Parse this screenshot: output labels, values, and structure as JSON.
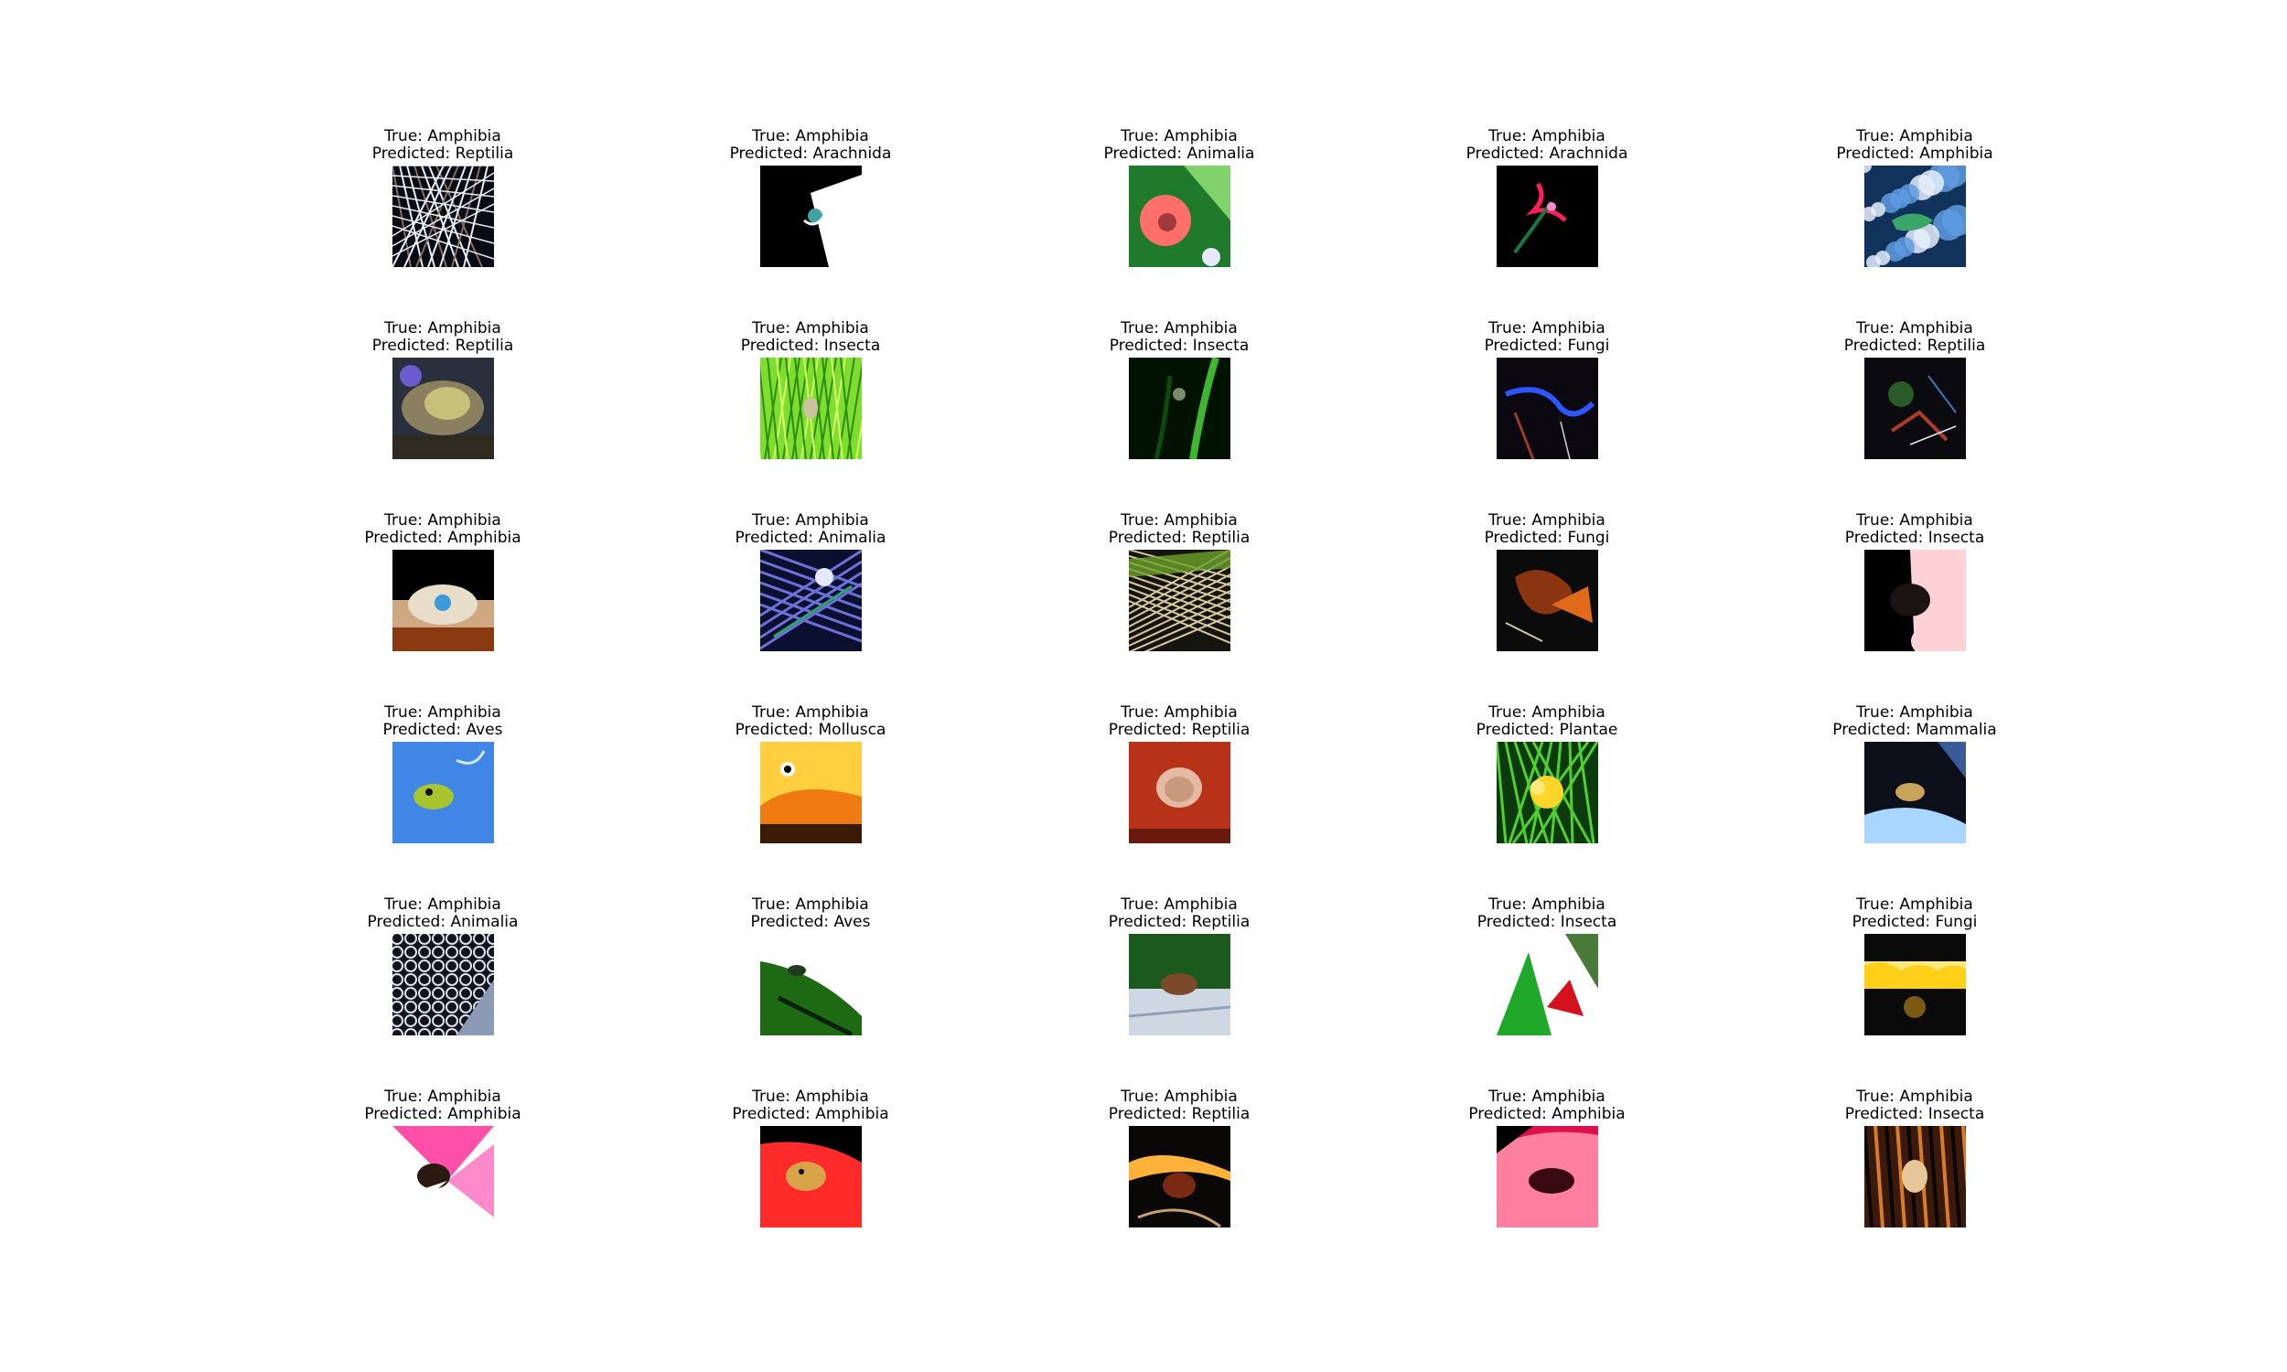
{
  "grid": [
    {
      "true_label": "True: Amphibia",
      "predicted_label": "Predicted: Reptilia",
      "scene": "twigs",
      "colors": [
        "#0b0b14",
        "#e9ecf3",
        "#7e6e64"
      ]
    },
    {
      "true_label": "True: Amphibia",
      "predicted_label": "Predicted: Arachnida",
      "scene": "dark-shape",
      "colors": [
        "#000000",
        "#ffffff",
        "#3fa3a5"
      ]
    },
    {
      "true_label": "True: Amphibia",
      "predicted_label": "Predicted: Animalia",
      "scene": "flower-leaves",
      "colors": [
        "#1f7a2c",
        "#ff6f6a",
        "#a13a3a"
      ]
    },
    {
      "true_label": "True: Amphibia",
      "predicted_label": "Predicted: Arachnida",
      "scene": "dark-flower",
      "colors": [
        "#000000",
        "#ff1e5a",
        "#167a3e"
      ]
    },
    {
      "true_label": "True: Amphibia",
      "predicted_label": "Predicted: Amphibia",
      "scene": "blue-rocks",
      "colors": [
        "#11325a",
        "#5f9be0",
        "#e6eefc"
      ]
    },
    {
      "true_label": "True: Amphibia",
      "predicted_label": "Predicted: Reptilia",
      "scene": "rocks-moss",
      "colors": [
        "#2a2f3c",
        "#c6c07a",
        "#6d5ad0"
      ]
    },
    {
      "true_label": "True: Amphibia",
      "predicted_label": "Predicted: Insecta",
      "scene": "grass",
      "colors": [
        "#7dde2e",
        "#2e8b16",
        "#d7ff6a"
      ]
    },
    {
      "true_label": "True: Amphibia",
      "predicted_label": "Predicted: Insecta",
      "scene": "dark-green",
      "colors": [
        "#001200",
        "#3eb630",
        "#0d4a0d"
      ]
    },
    {
      "true_label": "True: Amphibia",
      "predicted_label": "Predicted: Fungi",
      "scene": "dark-blue-stripe",
      "colors": [
        "#0b0810",
        "#2d56ff",
        "#9a3a2a"
      ]
    },
    {
      "true_label": "True: Amphibia",
      "predicted_label": "Predicted: Reptilia",
      "scene": "dark-debris",
      "colors": [
        "#0b0a0e",
        "#3a79b8",
        "#b03a2a"
      ]
    },
    {
      "true_label": "True: Amphibia",
      "predicted_label": "Predicted: Amphibia",
      "scene": "dark-spot",
      "colors": [
        "#000000",
        "#cfa780",
        "#3a9bd8"
      ]
    },
    {
      "true_label": "True: Amphibia",
      "predicted_label": "Predicted: Animalia",
      "scene": "blue-leaves",
      "colors": [
        "#0b1030",
        "#6c71d8",
        "#2ea56f"
      ]
    },
    {
      "true_label": "True: Amphibia",
      "predicted_label": "Predicted: Reptilia",
      "scene": "straw",
      "colors": [
        "#16140e",
        "#d9c9a3",
        "#6da12c"
      ]
    },
    {
      "true_label": "True: Amphibia",
      "predicted_label": "Predicted: Fungi",
      "scene": "dark-orange",
      "colors": [
        "#0c0b0c",
        "#e06a1a",
        "#8a3410"
      ]
    },
    {
      "true_label": "True: Amphibia",
      "predicted_label": "Predicted: Insecta",
      "scene": "hand-dark",
      "colors": [
        "#000000",
        "#ffd2d8",
        "#1a1412"
      ]
    },
    {
      "true_label": "True: Amphibia",
      "predicted_label": "Predicted: Aves",
      "scene": "blue-water",
      "colors": [
        "#3f86e6",
        "#a9c52e",
        "#1a3a7a"
      ]
    },
    {
      "true_label": "True: Amphibia",
      "predicted_label": "Predicted: Mollusca",
      "scene": "orange-frog",
      "colors": [
        "#ffcf3f",
        "#f07a12",
        "#3a1a04"
      ]
    },
    {
      "true_label": "True: Amphibia",
      "predicted_label": "Predicted: Reptilia",
      "scene": "red-clay",
      "colors": [
        "#b8321a",
        "#e5b9a3",
        "#6a1a0c"
      ]
    },
    {
      "true_label": "True: Amphibia",
      "predicted_label": "Predicted: Plantae",
      "scene": "green-yellow",
      "colors": [
        "#0d3a0d",
        "#ffd52a",
        "#4fd030"
      ]
    },
    {
      "true_label": "True: Amphibia",
      "predicted_label": "Predicted: Mammalia",
      "scene": "dark-water",
      "colors": [
        "#0b0f1a",
        "#c9a35a",
        "#a9d6ff"
      ]
    },
    {
      "true_label": "True: Amphibia",
      "predicted_label": "Predicted: Animalia",
      "scene": "mesh",
      "colors": [
        "#12141a",
        "#d9e3f0",
        "#8c9bb5"
      ]
    },
    {
      "true_label": "True: Amphibia",
      "predicted_label": "Predicted: Aves",
      "scene": "white-green",
      "colors": [
        "#ffffff",
        "#1e6a12",
        "#0a200a"
      ]
    },
    {
      "true_label": "True: Amphibia",
      "predicted_label": "Predicted: Reptilia",
      "scene": "leaves-stone",
      "colors": [
        "#1b5a1c",
        "#cfd7e2",
        "#7a4a2a"
      ]
    },
    {
      "true_label": "True: Amphibia",
      "predicted_label": "Predicted: Insecta",
      "scene": "green-red",
      "colors": [
        "#ffffff",
        "#1fa82a",
        "#d4121e"
      ]
    },
    {
      "true_label": "True: Amphibia",
      "predicted_label": "Predicted: Fungi",
      "scene": "yellow-band",
      "colors": [
        "#0a0a0a",
        "#ffcf1a",
        "#7a5a12"
      ]
    },
    {
      "true_label": "True: Amphibia",
      "predicted_label": "Predicted: Amphibia",
      "scene": "pink-petals",
      "colors": [
        "#ffffff",
        "#ff4fa8",
        "#2a1a10"
      ]
    },
    {
      "true_label": "True: Amphibia",
      "predicted_label": "Predicted: Amphibia",
      "scene": "red-hand",
      "colors": [
        "#000000",
        "#ff2a2a",
        "#d9a34a"
      ]
    },
    {
      "true_label": "True: Amphibia",
      "predicted_label": "Predicted: Reptilia",
      "scene": "dark-orange-2",
      "colors": [
        "#0a0806",
        "#ffb23a",
        "#7a2a10"
      ]
    },
    {
      "true_label": "True: Amphibia",
      "predicted_label": "Predicted: Amphibia",
      "scene": "pink-hand",
      "colors": [
        "#e0114a",
        "#ff7fa0",
        "#3a0a12"
      ]
    },
    {
      "true_label": "True: Amphibia",
      "predicted_label": "Predicted: Insecta",
      "scene": "brown-wood",
      "colors": [
        "#3a1a0c",
        "#d97a2a",
        "#0a0604"
      ]
    }
  ]
}
